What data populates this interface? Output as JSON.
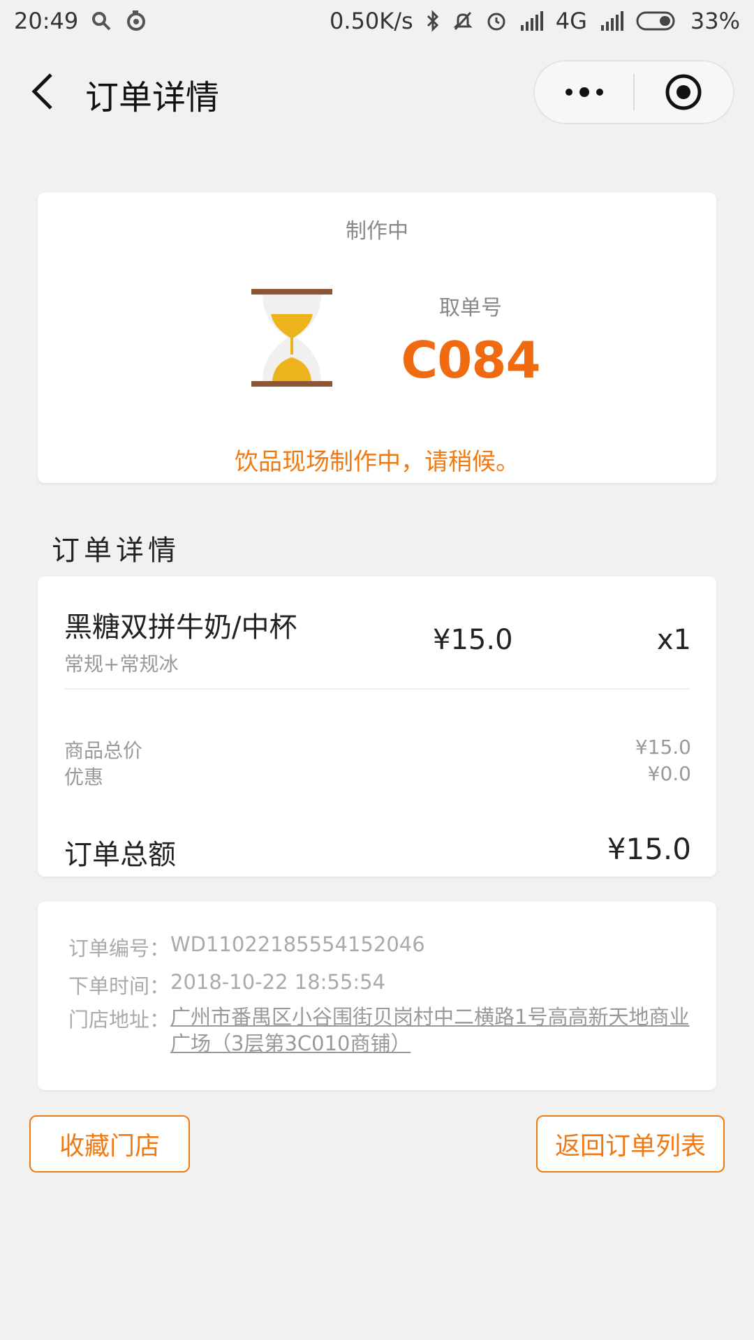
{
  "status_bar": {
    "time": "20:49",
    "network_speed": "0.50K/s",
    "network_type": "4G",
    "battery": "33%",
    "icons": [
      "search-icon",
      "netease-icon",
      "bluetooth-icon",
      "mute-icon",
      "alarm-icon",
      "signal-icon",
      "signal-icon",
      "battery-icon"
    ]
  },
  "nav": {
    "title": "订单详情",
    "back_icon": "chevron-left-icon",
    "more_icon": "more-dots-icon",
    "close_icon": "target-icon"
  },
  "status_card": {
    "status": "制作中",
    "pickup_label": "取单号",
    "pickup_code": "C084",
    "message": "饮品现场制作中，请稍候。",
    "icon": "hourglass-icon"
  },
  "section_heading": "订单详情",
  "order": {
    "item": {
      "name": "黑糖双拼牛奶/中杯",
      "spec": "常规+常规冰",
      "price": "¥15.0",
      "quantity": "x1"
    },
    "subtotal_label": "商品总价",
    "subtotal_value": "¥15.0",
    "discount_label": "优惠",
    "discount_value": "¥0.0",
    "total_label": "订单总额",
    "total_value": "¥15.0"
  },
  "info": {
    "order_no_label": "订单编号：",
    "order_no": "WD11022185554152046",
    "time_label": "下单时间：",
    "time": "2018-10-22 18:55:54",
    "address_label": "门店地址：",
    "address": "广州市番禺区小谷围街贝岗村中二横路1号高高新天地商业广场（3层第3C010商铺）"
  },
  "buttons": {
    "favorite": "收藏门店",
    "back_to_list": "返回订单列表"
  },
  "colors": {
    "accent": "#ef7a14",
    "pickup_code": "#ef6a10",
    "background": "#f1f1f1"
  }
}
